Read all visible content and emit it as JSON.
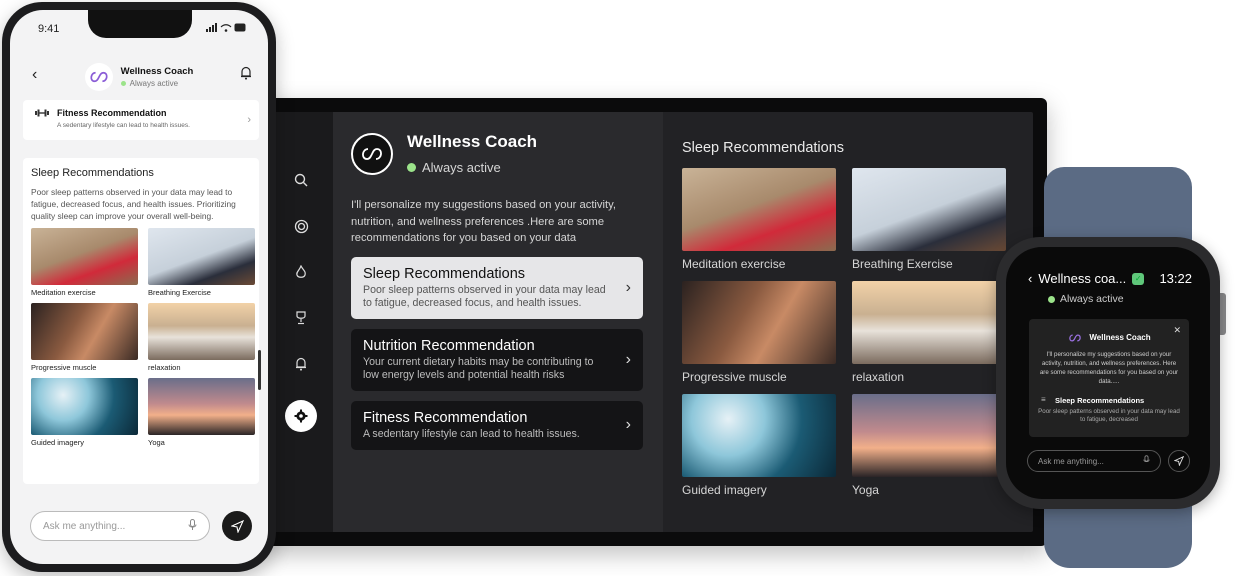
{
  "tv": {
    "coach_name": "Wellness Coach",
    "status": "Always active",
    "intro": "I'll personalize my suggestions based on your activity, nutrition, and wellness preferences .Here are some recommendations for you based on your data",
    "recommendations": [
      {
        "title": "Sleep Recommendations",
        "desc": "Poor sleep patterns observed in your data may lead to fatigue, decreased focus, and health issues."
      },
      {
        "title": "Nutrition Recommendation",
        "desc": "Your current dietary habits may be contributing to low energy levels and potential health risks"
      },
      {
        "title": "Fitness Recommendation",
        "desc": "A sedentary lifestyle can lead to health issues."
      }
    ],
    "gallery_title": "Sleep Recommendations",
    "tiles": [
      {
        "caption": "Meditation exercise"
      },
      {
        "caption": "Breathing Exercise"
      },
      {
        "caption": "Progressive muscle"
      },
      {
        "caption": "relaxation"
      },
      {
        "caption": "Guided imagery"
      },
      {
        "caption": "Yoga"
      }
    ],
    "rail_icons": [
      "search-icon",
      "activity-ring-icon",
      "flame-icon",
      "trophy-icon",
      "bell-icon",
      "settings-icon"
    ]
  },
  "phone": {
    "time": "9:41",
    "coach_name": "Wellness Coach",
    "status": "Always active",
    "fitness_title": "Fitness Recommendation",
    "fitness_desc": "A sedentary lifestyle can lead to health issues.",
    "sleep_title": "Sleep Recommendations",
    "sleep_desc": "Poor sleep patterns observed in your data may lead to fatigue, decreased focus, and health issues. Prioritizing quality sleep can improve your overall well-being.",
    "tiles": [
      {
        "caption": "Meditation exercise"
      },
      {
        "caption": "Breathing Exercise"
      },
      {
        "caption": "Progressive muscle"
      },
      {
        "caption": "relaxation"
      },
      {
        "caption": "Guided imagery"
      },
      {
        "caption": "Yoga"
      }
    ],
    "input_placeholder": "Ask me anything..."
  },
  "watch": {
    "title": "Wellness coa...",
    "time": "13:22",
    "status": "Always active",
    "coach_name": "Wellness Coach",
    "intro": "I'll personalize my suggestions based on your activity, nutrition, and wellness preferences. Here are some recommendations for you based on your data.....",
    "rec_title": "Sleep Recommendations",
    "rec_desc": "Poor sleep patterns observed in your data may lead to fatigue, decreased",
    "input_placeholder": "Ask me anything..."
  }
}
